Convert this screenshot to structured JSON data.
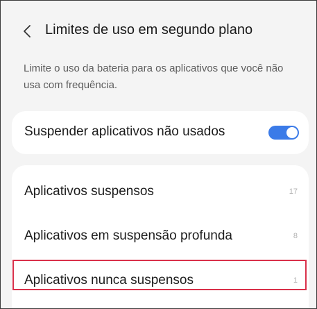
{
  "header": {
    "back_icon": "chevron-left-icon",
    "title": "Limites de uso em segundo plano"
  },
  "description": "Limite o uso da bateria para os aplicativos que você não usa com frequência.",
  "toggle_setting": {
    "label": "Suspender aplicativos não usados",
    "enabled": true,
    "accent_color": "#3b7be8"
  },
  "app_lists": [
    {
      "label": "Aplicativos suspensos",
      "count": "17"
    },
    {
      "label": "Aplicativos em suspensão profunda",
      "count": "8"
    },
    {
      "label": "Aplicativos nunca suspensos",
      "count": "1"
    }
  ],
  "highlight_color": "#d9304a"
}
